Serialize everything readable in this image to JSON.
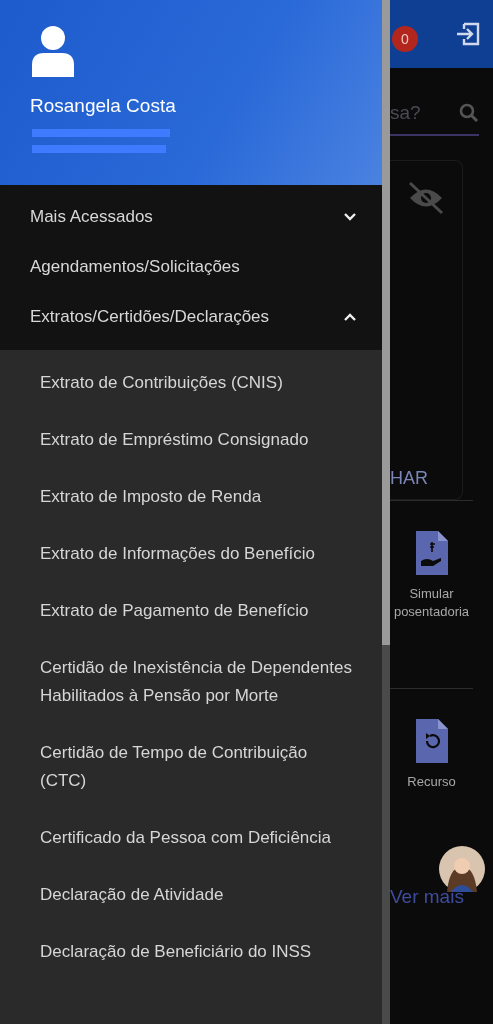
{
  "drawer": {
    "user": {
      "name": "Rosangela Costa"
    },
    "menu": [
      {
        "label": "Mais Acessados",
        "expanded": false
      },
      {
        "label": "Agendamentos/Solicitações"
      },
      {
        "label": "Extratos/Certidões/Declarações",
        "expanded": true,
        "children": [
          {
            "label": "Extrato de Contribuições (CNIS)"
          },
          {
            "label": "Extrato de Empréstimo Consignado"
          },
          {
            "label": "Extrato de Imposto de Renda"
          },
          {
            "label": "Extrato de Informações do Benefício"
          },
          {
            "label": "Extrato de Pagamento de Benefício"
          },
          {
            "label": "Certidão de Inexistência de Dependentes Habilitados à Pensão por Morte"
          },
          {
            "label": "Certidão de Tempo de Contribuição (CTC)"
          },
          {
            "label": "Certificado da Pessoa com Deficiência"
          },
          {
            "label": "Declaração de Atividade"
          },
          {
            "label": "Declaração de Beneficiário do INSS"
          }
        ]
      }
    ]
  },
  "background": {
    "notifications_badge": "0",
    "search": {
      "placeholder": "sa?"
    },
    "card": {
      "action": "HAR"
    },
    "services": [
      {
        "kind": "simulate",
        "label_lines": [
          "Simular",
          "posentadoria"
        ]
      },
      {
        "kind": "appeal",
        "label_lines": [
          "Recurso"
        ]
      }
    ],
    "more_link": "Ver mais"
  }
}
